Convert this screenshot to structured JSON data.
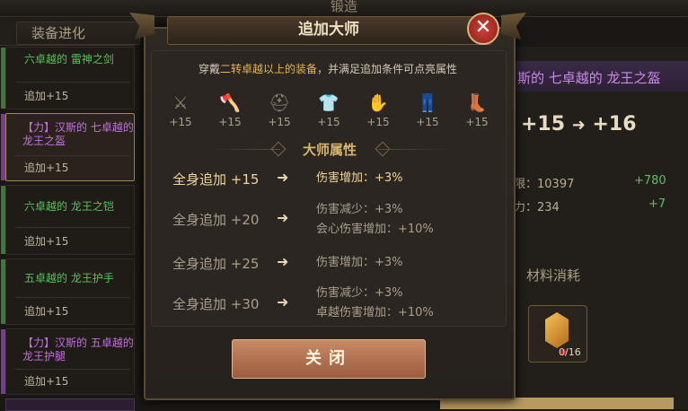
{
  "top": {
    "title": "锻造"
  },
  "tabs": {
    "equip_evolve": "装备进化"
  },
  "items": [
    {
      "name": "六卓越的 雷神之剑",
      "level": "追加+15",
      "color": "green"
    },
    {
      "name": "【力】汉斯的 七卓越的 龙王之盔",
      "level": "追加+15",
      "color": "purple",
      "selected": true
    },
    {
      "name": "六卓越的 龙王之铠",
      "level": "追加+15",
      "color": "green"
    },
    {
      "name": "五卓越的 龙王护手",
      "level": "追加+15",
      "color": "green"
    },
    {
      "name": "【力】汉斯的 五卓越的 龙王护腿",
      "level": "追加+15",
      "color": "purple"
    }
  ],
  "right": {
    "title": "斯的 七卓越的 龙王之盔",
    "level_from": "+15",
    "level_to": "+16",
    "stats": [
      {
        "label": "限：10397",
        "add": "+780"
      },
      {
        "label": "力：234",
        "add": "+7"
      }
    ],
    "materials_title": "材料消耗",
    "material_count": "0/16"
  },
  "dialog": {
    "title": "追加大师",
    "hint_pre": "穿戴",
    "hint_hl": "二转卓越以上的装备",
    "hint_post": "，并满足追加条件可点亮属性",
    "slots": [
      {
        "icon": "sword-icon",
        "glyph": "⚔",
        "level": "+15"
      },
      {
        "icon": "axe-icon",
        "glyph": "🪓",
        "level": "+15"
      },
      {
        "icon": "helmet-icon",
        "glyph": "⛑",
        "level": "+15"
      },
      {
        "icon": "armor-icon",
        "glyph": "👕",
        "level": "+15"
      },
      {
        "icon": "gauntlet-icon",
        "glyph": "✋",
        "level": "+15"
      },
      {
        "icon": "pants-icon",
        "glyph": "👖",
        "level": "+15"
      },
      {
        "icon": "boots-icon",
        "glyph": "👢",
        "level": "+15"
      }
    ],
    "section_title": "大师属性",
    "attributes": [
      {
        "req": "全身追加 +15",
        "effects": [
          "伤害增加：+3%"
        ],
        "active": true
      },
      {
        "req": "全身追加 +20",
        "effects": [
          "伤害减少：+3%",
          "会心伤害增加：+10%"
        ],
        "active": false
      },
      {
        "req": "全身追加 +25",
        "effects": [
          "伤害增加：+3%"
        ],
        "active": false
      },
      {
        "req": "全身追加 +30",
        "effects": [
          "伤害减少：+3%",
          "卓越伤害增加：+10%"
        ],
        "active": false
      }
    ],
    "close_label": "关闭"
  }
}
